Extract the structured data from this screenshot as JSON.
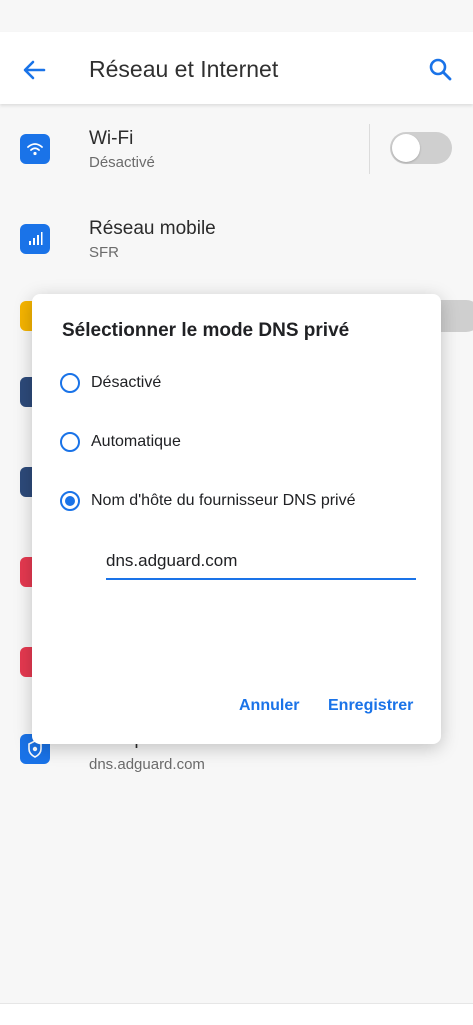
{
  "appbar": {
    "title": "Réseau et Internet",
    "back_icon": "arrow-back-icon",
    "search_icon": "search-icon"
  },
  "colors": {
    "accent": "#1a73e8",
    "icon_blue": "#1a73e8"
  },
  "list": {
    "wifi": {
      "title": "Wi-Fi",
      "subtitle": "Désactivé",
      "toggle_on": false,
      "icon": "wifi-icon"
    },
    "mobile": {
      "title": "Réseau mobile",
      "subtitle": "SFR",
      "icon": "cellular-signal-icon"
    },
    "private_dns": {
      "title": "DNS privé",
      "subtitle": "dns.adguard.com",
      "icon": "shield-dns-icon"
    }
  },
  "dialog": {
    "title": "Sélectionner le mode DNS privé",
    "options": [
      {
        "label": "Désactivé",
        "selected": false
      },
      {
        "label": "Automatique",
        "selected": false
      },
      {
        "label": "Nom d'hôte du fournisseur DNS privé",
        "selected": true
      }
    ],
    "hostname_value": "dns.adguard.com",
    "cancel_label": "Annuler",
    "save_label": "Enregistrer"
  }
}
